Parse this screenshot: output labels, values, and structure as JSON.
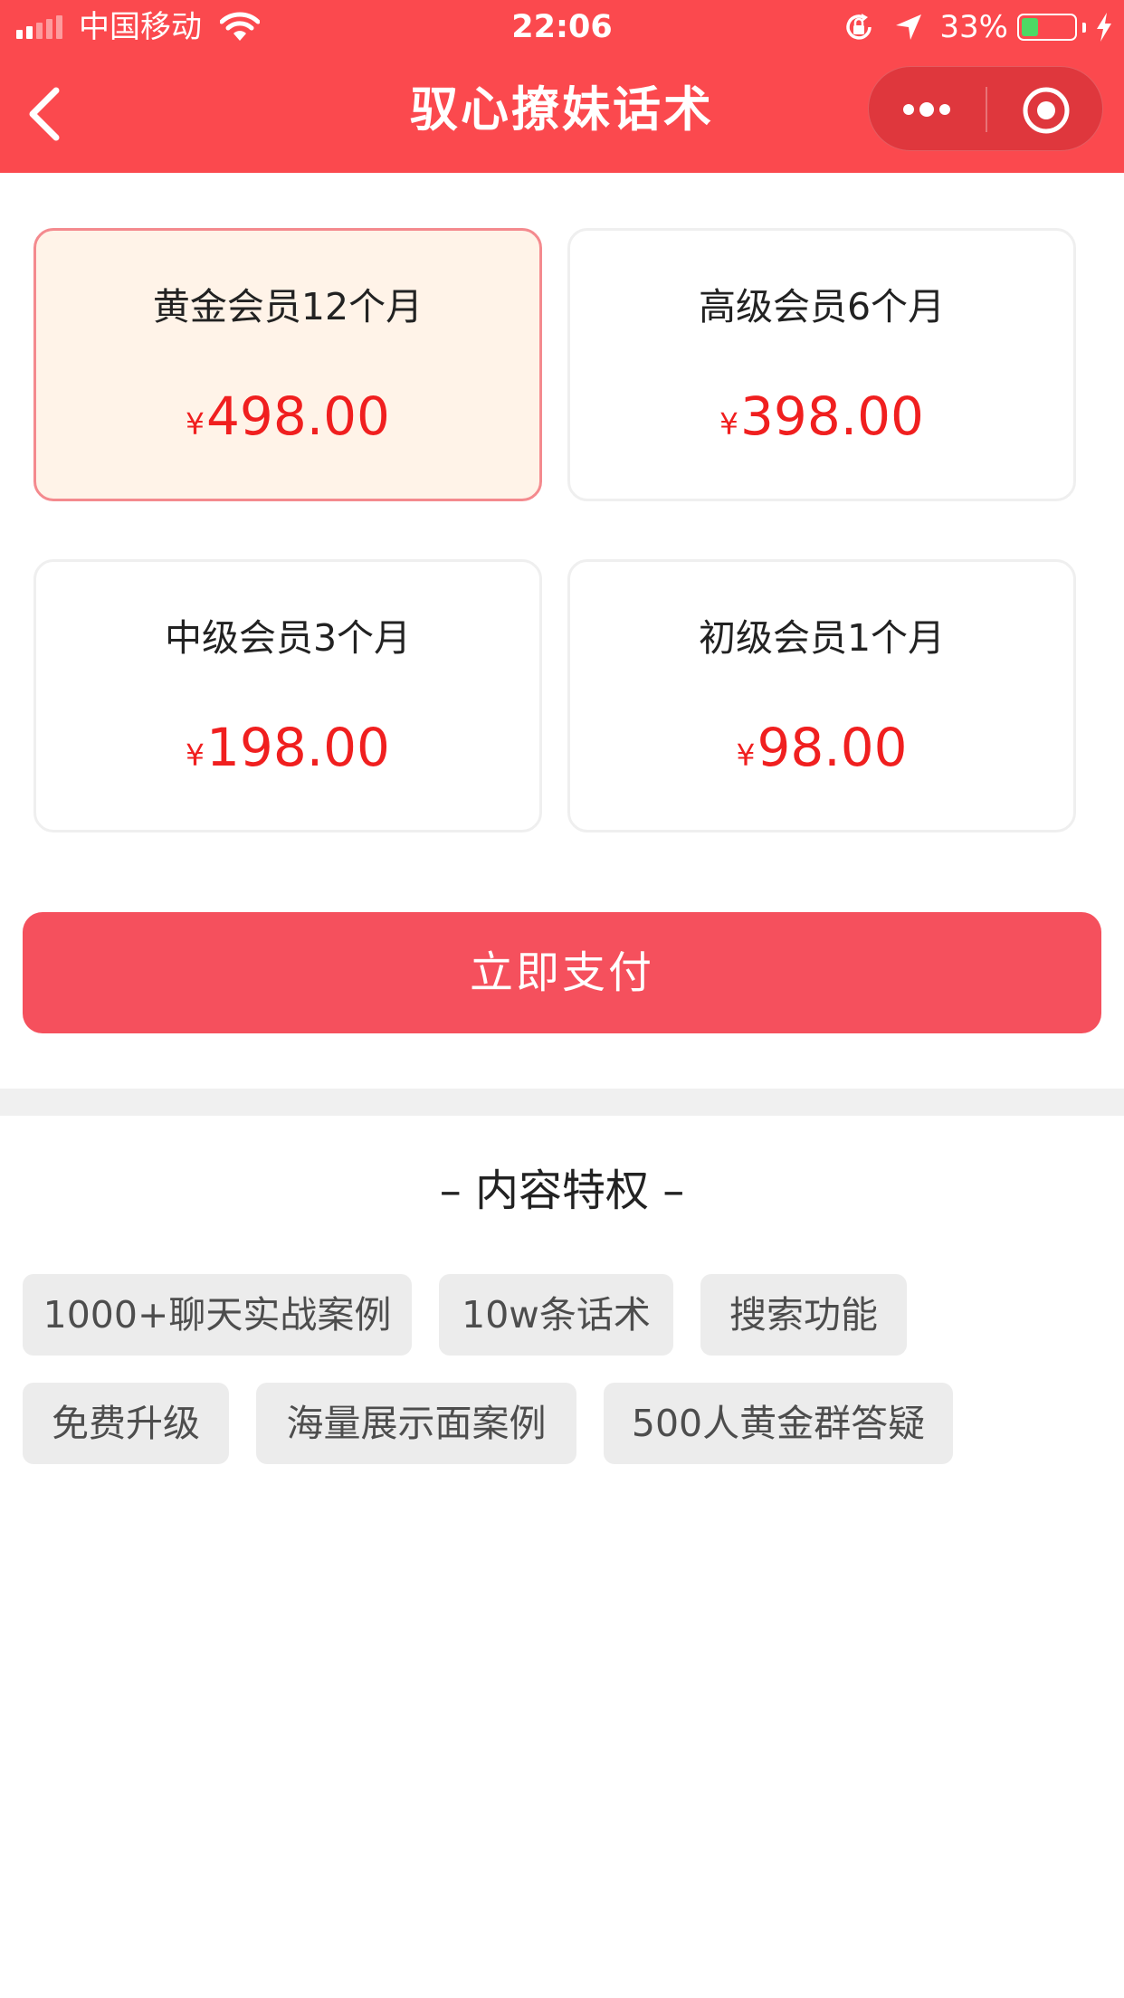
{
  "status_bar": {
    "carrier": "中国移动",
    "time": "22:06",
    "battery_percent": "33%",
    "battery_level": 0.33,
    "colors": {
      "battery_fill": "#4cd964"
    }
  },
  "nav": {
    "title": "驭心撩妹话术",
    "back_icon": "chevron-left-icon",
    "more_icon": "more-dots-icon",
    "close_icon": "target-icon",
    "background": "#fb494e"
  },
  "plans": [
    {
      "name": "黄金会员12个月",
      "currency": "¥",
      "price": "498.00",
      "selected": true
    },
    {
      "name": "高级会员6个月",
      "currency": "¥",
      "price": "398.00",
      "selected": false
    },
    {
      "name": "中级会员3个月",
      "currency": "¥",
      "price": "198.00",
      "selected": false
    },
    {
      "name": "初级会员1个月",
      "currency": "¥",
      "price": "98.00",
      "selected": false
    }
  ],
  "pay_button": {
    "label": "立即支付",
    "color": "#f5505d"
  },
  "privileges": {
    "title": "– 内容特权 –",
    "tags": [
      "1000+聊天实战案例",
      "10w条话术",
      "搜索功能",
      "免费升级",
      "海量展示面案例",
      "500人黄金群答疑"
    ]
  },
  "colors": {
    "price": "#f01f1f",
    "selected_bg": "#fff3e8",
    "selected_border": "#f48a8e"
  }
}
